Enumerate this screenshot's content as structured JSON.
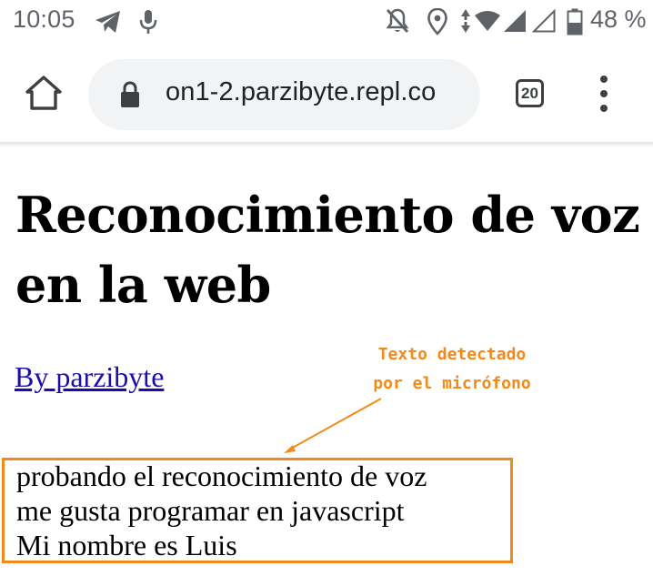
{
  "status_bar": {
    "time": "10:05",
    "battery_percent": "48 %",
    "icons": [
      "telegram-icon",
      "microphone-icon",
      "notifications-off-icon",
      "location-icon",
      "data-arrows-icon",
      "wifi-icon",
      "signal-icon",
      "signal-empty-icon",
      "battery-icon"
    ]
  },
  "browser": {
    "url": "on1-2.parzibyte.repl.co",
    "tab_count": "20",
    "icons": [
      "home-icon",
      "lock-icon",
      "tabs-icon",
      "more-vert-icon"
    ]
  },
  "page": {
    "title": "Reconocimiento de voz en la web",
    "author_link": "By parzibyte",
    "annotation_line1": "Texto detectado",
    "annotation_line2": "por el micrófono",
    "transcript": [
      "probando el reconocimiento de voz",
      "me gusta programar en javascript",
      "Mi nombre es Luis"
    ]
  },
  "colors": {
    "annotation": "#f28a1b",
    "link": "#1a0dab",
    "omnibox_bg": "#f1f3f4",
    "status_gray": "#5f6368"
  }
}
